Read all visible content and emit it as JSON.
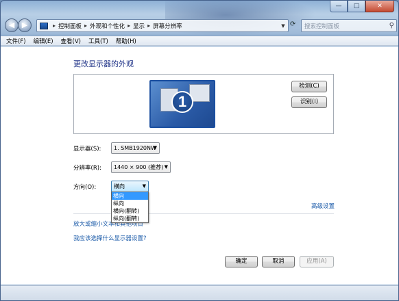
{
  "window": {
    "controls": {
      "minimize": "—",
      "maximize": "□",
      "close": "✕"
    }
  },
  "nav": {
    "back_icon": "◀",
    "forward_icon": "▶",
    "breadcrumbs": [
      "控制面板",
      "外观和个性化",
      "显示",
      "屏幕分辨率"
    ],
    "breadcrumb_sep": "▸",
    "dropdown_icon": "▼",
    "refresh_icon": "⟳",
    "search_placeholder": "搜索控制面板",
    "search_icon": "⚲"
  },
  "menu": [
    "文件(F)",
    "编辑(E)",
    "查看(V)",
    "工具(T)",
    "帮助(H)"
  ],
  "page": {
    "title": "更改显示器的外观",
    "monitor_number": "1",
    "detect_button": "检测(C)",
    "identify_button": "识别(I)",
    "display_label": "显示器(S):",
    "display_value": "1. SMB1920NW",
    "resolution_label": "分辨率(R):",
    "resolution_value": "1440 × 900 (推荐)",
    "orientation_label": "方向(O):",
    "orientation_value": "横向",
    "orientation_options": [
      "横向",
      "纵向",
      "横向(翻转)",
      "纵向(翻转)"
    ],
    "advanced_link": "高级设置",
    "scale_link": "放大或缩小文本和其他项目",
    "which_link": "我应该选择什么显示器设置?",
    "ok_button": "确定",
    "cancel_button": "取消",
    "apply_button": "应用(A)",
    "combo_arrow": "▼"
  }
}
